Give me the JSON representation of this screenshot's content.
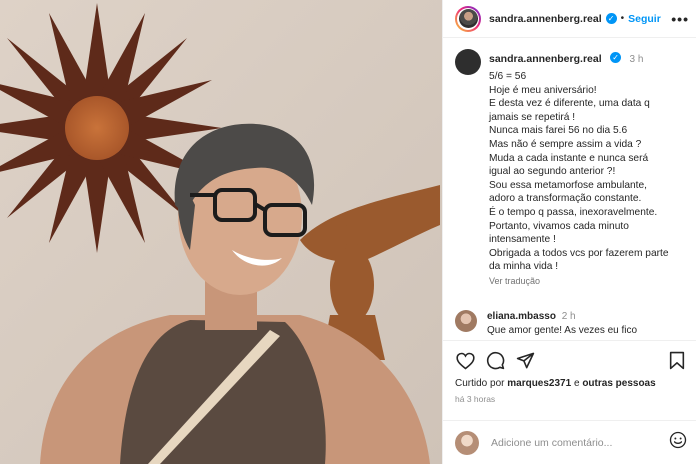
{
  "header": {
    "username": "sandra.annenberg.real",
    "follow_label": "Seguir",
    "more": "•••"
  },
  "caption": {
    "username": "sandra.annenberg.real",
    "time": "3 h",
    "lines": [
      "5/6 = 56",
      "Hoje é meu aniversário!",
      "E desta vez é diferente, uma data q",
      "jamais se repetirá !",
      "Nunca mais farei 56 no dia 5.6",
      "Mas não é sempre assim a vida ?",
      "Muda a cada instante e nunca será",
      "igual ao segundo anterior ?!",
      "Sou essa metamorfose ambulante,",
      "adoro a transformação constante.",
      "É o tempo q passa, inexoravelmente.",
      "Portanto, vivamos cada minuto",
      "intensamente !",
      "Obrigada a todos vcs por fazerem parte",
      "da minha vida !"
    ],
    "translate_label": "Ver tradução"
  },
  "comment": {
    "username": "eliana.mbasso",
    "time": "2 h",
    "text": "Que amor gente! As vezes eu fico"
  },
  "likes": {
    "prefix": "Curtido por ",
    "user": "marques2371",
    "middle": " e ",
    "others": "outras pessoas"
  },
  "when": "há 3 horas",
  "add_comment": {
    "placeholder": "Adicione um comentário..."
  },
  "icons": [
    "heart-icon",
    "comment-icon",
    "share-icon",
    "bookmark-icon",
    "emoji-icon",
    "verified-icon",
    "more-icon"
  ],
  "colors": {
    "accent": "#0095f6",
    "text": "#262626",
    "muted": "#8e8e8e"
  }
}
